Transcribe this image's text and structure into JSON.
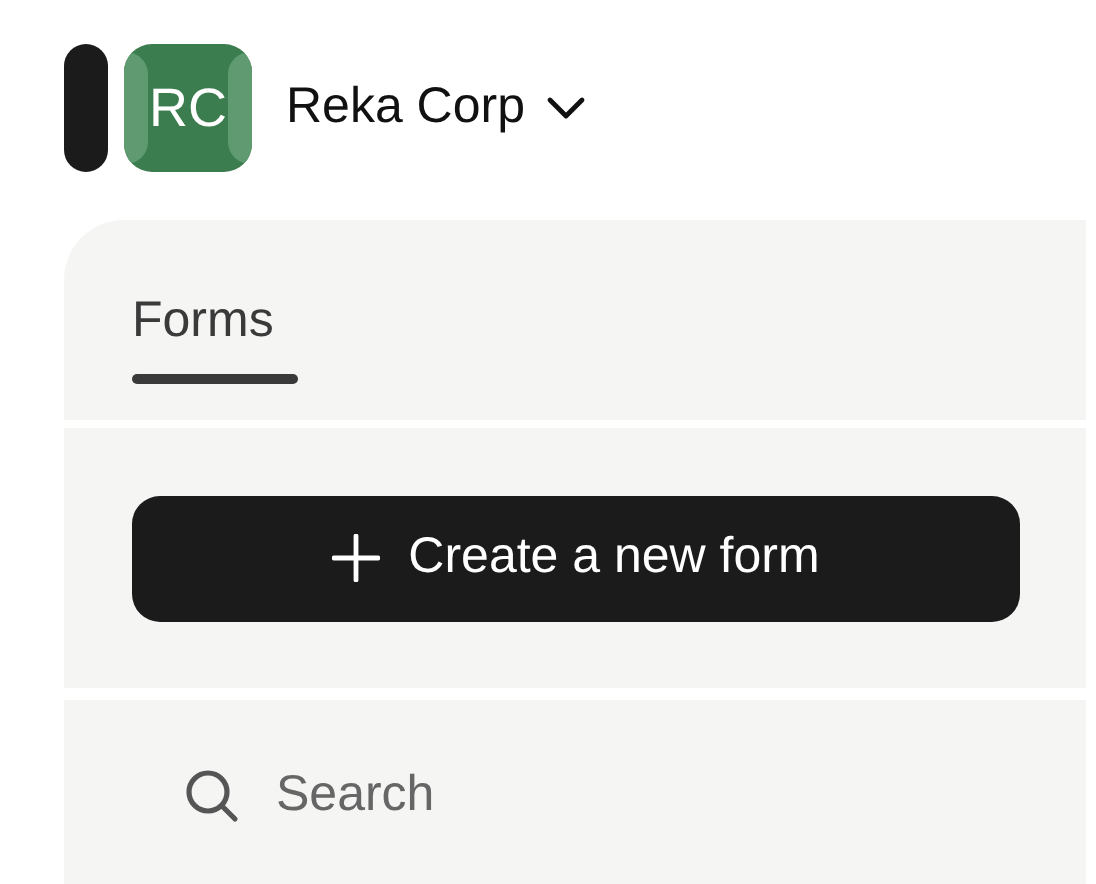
{
  "workspace": {
    "initials": "RC",
    "name": "Reka Corp"
  },
  "tabs": [
    {
      "label": "Forms",
      "selected": true
    }
  ],
  "create_button": {
    "label": "Create a new form"
  },
  "search": {
    "placeholder": "Search"
  }
}
